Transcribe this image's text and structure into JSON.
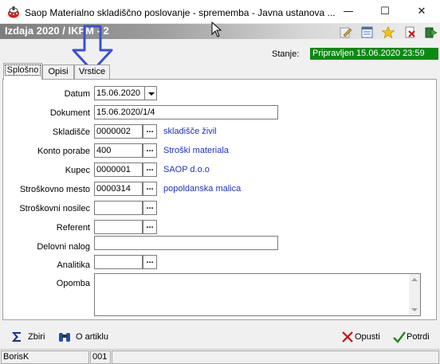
{
  "window": {
    "title": "Saop Materialno skladiščno poslovanje - sprememba - Javna ustanova ...",
    "min_label": "—",
    "max_label": "☐",
    "close_label": "✕"
  },
  "header": {
    "doc_title": "Izdaja 2020 / IKPM - 2",
    "icons": [
      "edit-icon",
      "document-list-icon",
      "star-icon",
      "delete-icon",
      "exit-icon"
    ]
  },
  "status": {
    "label": "Stanje:",
    "value": "Pripravljen 15.06.2020 23:59",
    "color": "#0b8a12"
  },
  "tabs": [
    {
      "label": "Splošno",
      "active": true
    },
    {
      "label": "Opisi",
      "active": false
    },
    {
      "label": "Vrstice",
      "active": false
    }
  ],
  "form": {
    "datum": {
      "label": "Datum",
      "value": "15.06.2020"
    },
    "dokument": {
      "label": "Dokument",
      "value": "15.06.2020/1/4"
    },
    "skladisce": {
      "label": "Skladišče",
      "value": "0000002",
      "desc": "skladišče živil"
    },
    "konto_porabe": {
      "label": "Konto porabe",
      "value": "400",
      "desc": "Stroški materiala"
    },
    "kupec": {
      "label": "Kupec",
      "value": "0000001",
      "desc": "SAOP d.o.o"
    },
    "strosk_mesto": {
      "label": "Stroškovno mesto",
      "value": "0000314",
      "desc": "popoldanska malica"
    },
    "strosk_nosilec": {
      "label": "Stroškovni nosilec",
      "value": ""
    },
    "referent": {
      "label": "Referent",
      "value": ""
    },
    "delovni_nalog": {
      "label": "Delovni nalog",
      "value": ""
    },
    "analitika": {
      "label": "Analitika",
      "value": ""
    },
    "opomba": {
      "label": "Opomba",
      "value": ""
    },
    "browse_label": "..."
  },
  "toolbar": {
    "zbiri": "Zbiri",
    "o_artiklu": "O artiklu",
    "opusti": "Opusti",
    "potrdi": "Potrdi"
  },
  "statusbar": {
    "user": "BorisK",
    "code": "001"
  },
  "colors": {
    "accent_link": "#1f2fc6",
    "annotation_arrow": "#3a4fd6"
  }
}
